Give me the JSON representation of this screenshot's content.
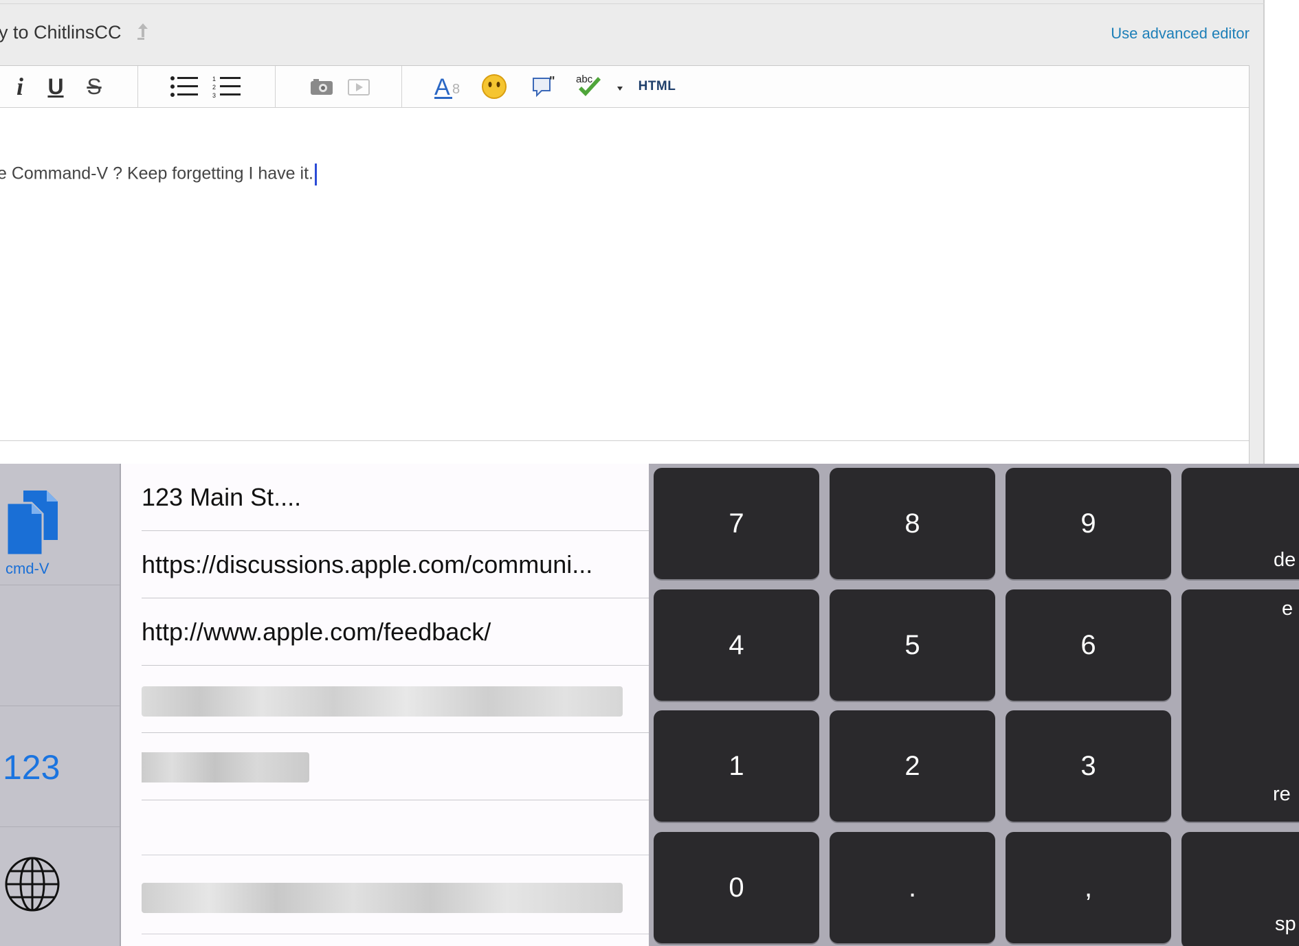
{
  "editor": {
    "reply_title": "y to ChitlinsCC",
    "advanced_link": "Use advanced editor",
    "toolbar": {
      "italic": "i",
      "underline": "U",
      "strike": "S",
      "html": "HTML",
      "spell_label": "abc"
    },
    "body_text": "e Command-V ? Keep forgetting I have it."
  },
  "sidebar": {
    "cmdv_label": "cmd-V",
    "numbers_label": "123"
  },
  "clipboard": {
    "items": [
      "123 Main St....",
      "https://discussions.apple.com/communi...",
      "http://www.apple.com/feedback/"
    ]
  },
  "numpad": {
    "keys": [
      "7",
      "8",
      "9",
      "4",
      "5",
      "6",
      "1",
      "2",
      "3",
      "0",
      ".",
      ","
    ],
    "side_keys": {
      "delete": "de",
      "emoji": "e",
      "return": "re",
      "space": "sp"
    }
  },
  "colors": {
    "link": "#1d7fb8",
    "key": "#2a292c",
    "keyboard_bg": "#adabb5",
    "sidebar_bg": "#c4c3cb",
    "accent_blue": "#1a74e0"
  }
}
